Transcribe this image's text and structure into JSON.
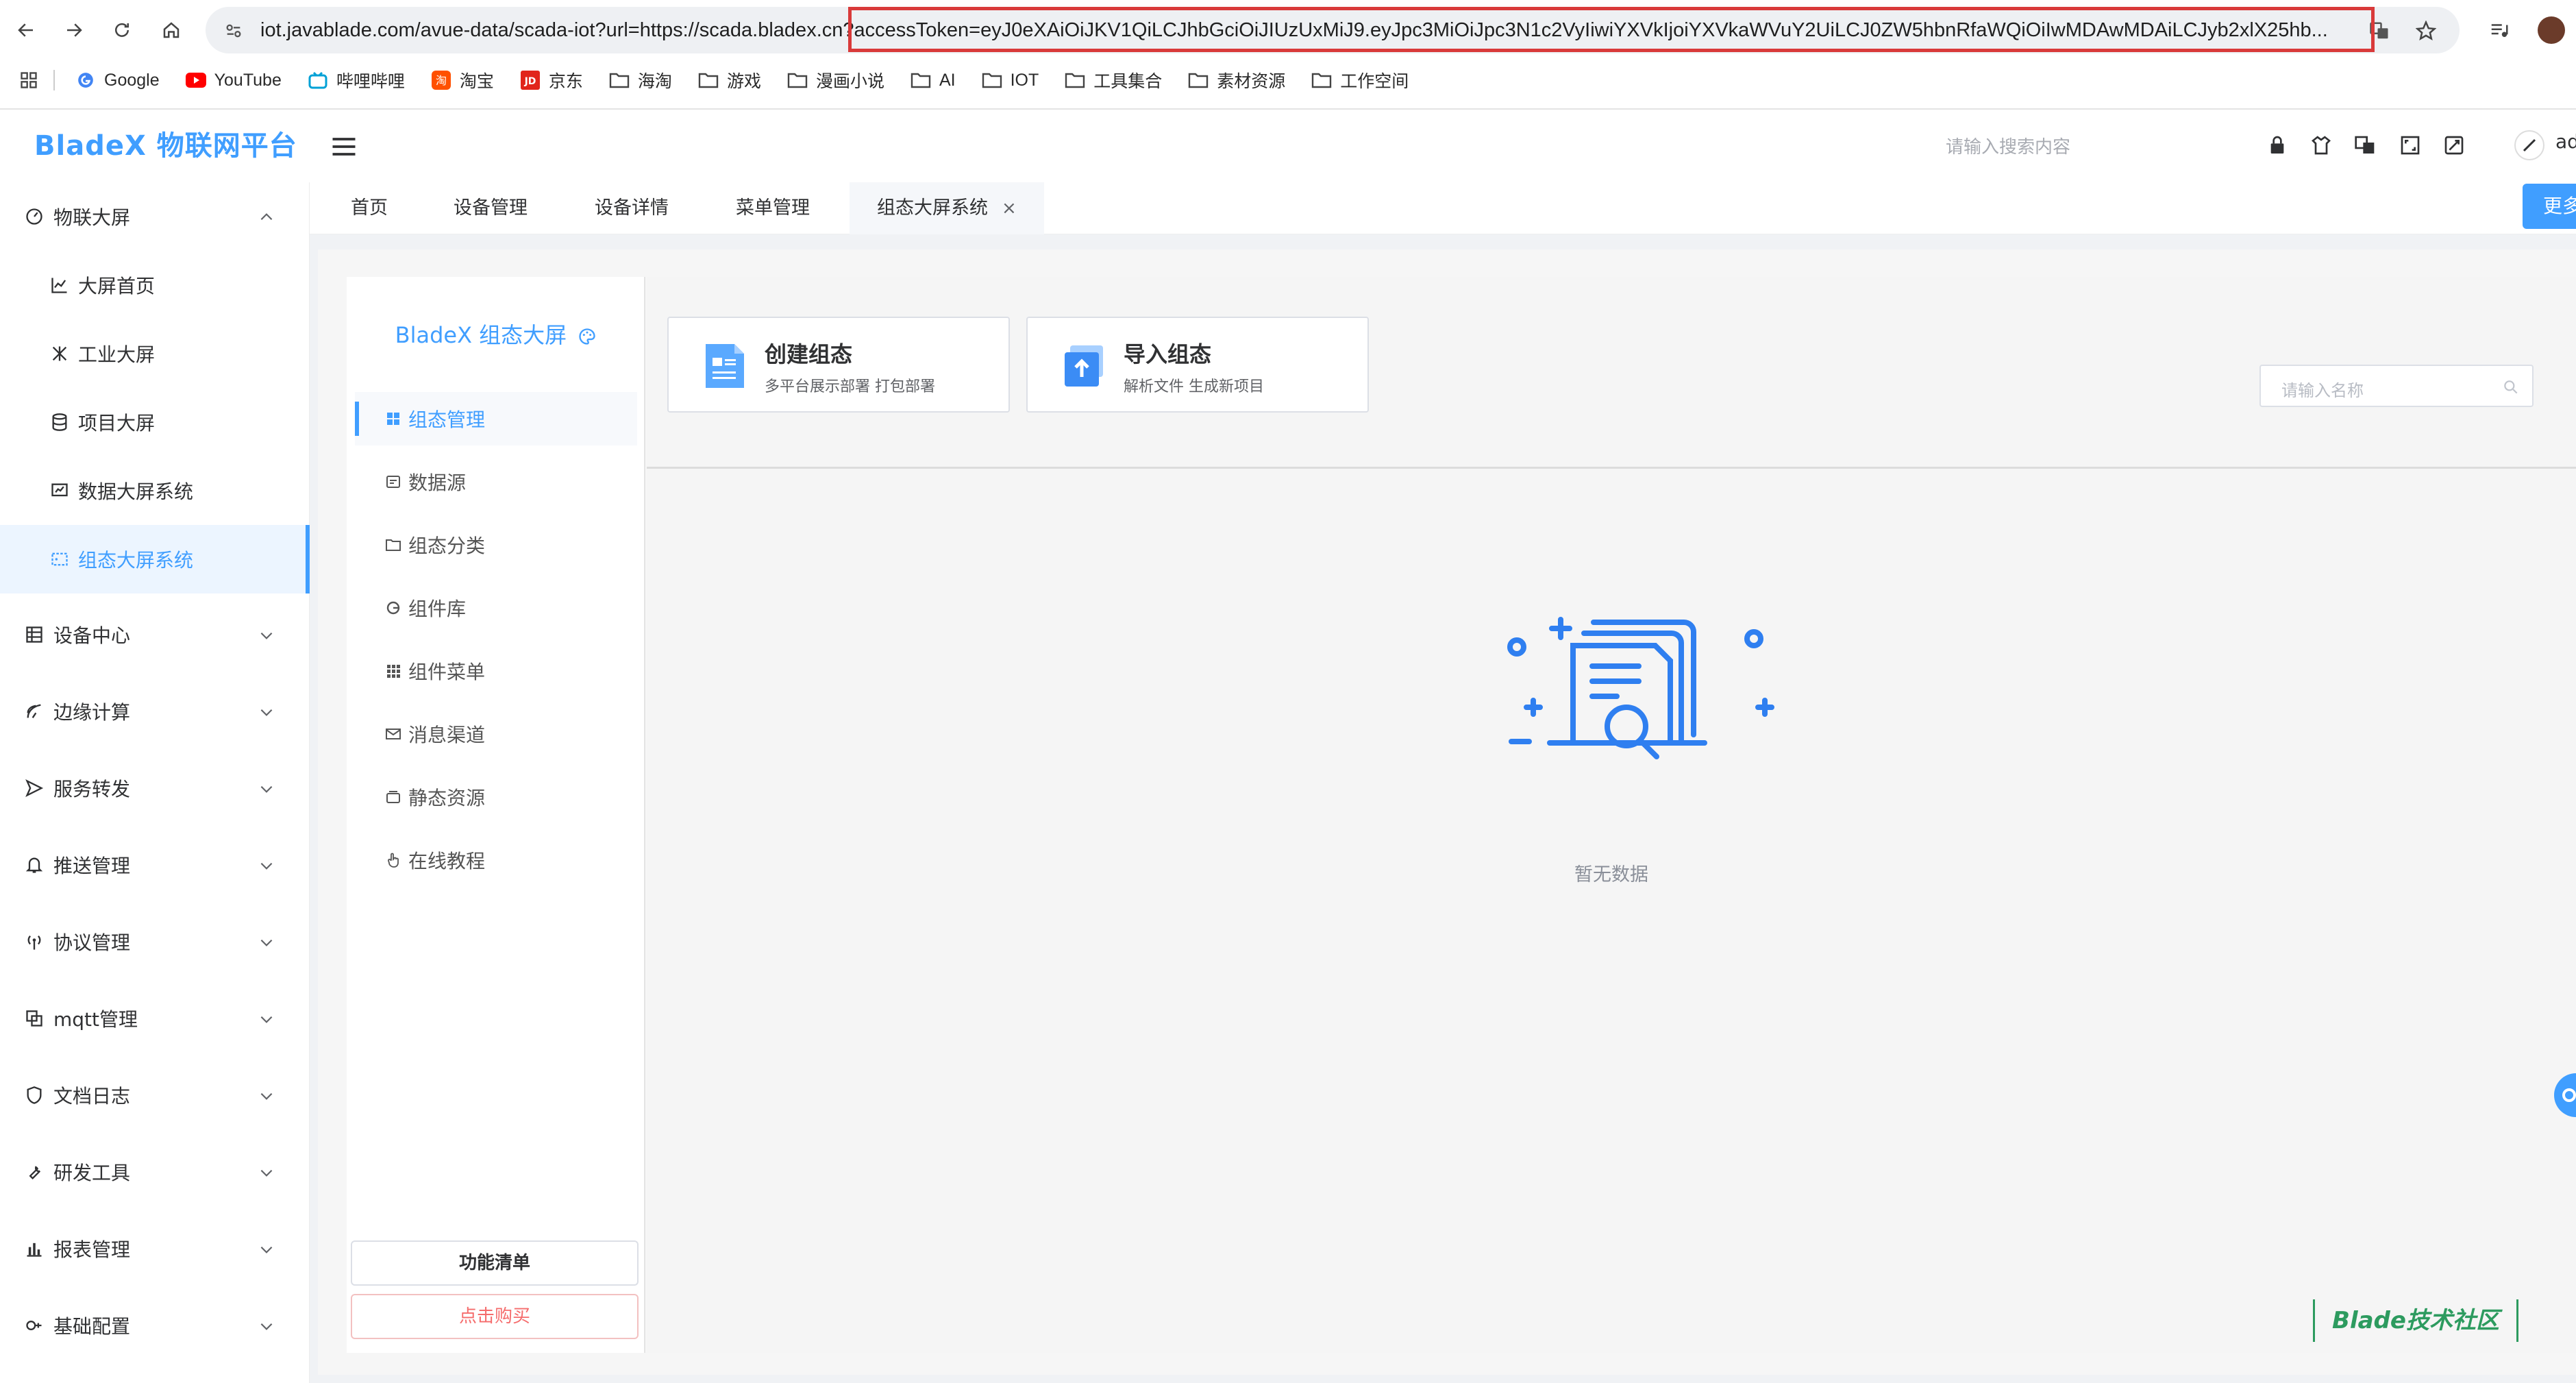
{
  "browser": {
    "url": "iot.javablade.com/avue-data/scada-iot?url=https://scada.bladex.cn?accessToken=eyJ0eXAiOiJKV1QiLCJhbGciOiJIUzUxMiJ9.eyJpc3MiOiJpc3N1c2VyIiwiYXVkIjoiYXVkaWVuY2UiLCJ0ZW5hbnRfaWQiOiIwMDAwMDAiLCJyb2xlX25hb...",
    "bookmarks": [
      {
        "label": "Google",
        "icon": "google-icon"
      },
      {
        "label": "YouTube",
        "icon": "youtube-icon"
      },
      {
        "label": "哔哩哔哩",
        "icon": "bilibili-icon"
      },
      {
        "label": "淘宝",
        "icon": "taobao-icon"
      },
      {
        "label": "京东",
        "icon": "jd-icon"
      },
      {
        "label": "海淘",
        "icon": "folder-icon"
      },
      {
        "label": "游戏",
        "icon": "folder-icon"
      },
      {
        "label": "漫画小说",
        "icon": "folder-icon"
      },
      {
        "label": "AI",
        "icon": "folder-icon"
      },
      {
        "label": "IOT",
        "icon": "folder-icon"
      },
      {
        "label": "工具集合",
        "icon": "folder-icon"
      },
      {
        "label": "素材资源",
        "icon": "folder-icon"
      },
      {
        "label": "工作空间",
        "icon": "folder-icon"
      }
    ]
  },
  "header": {
    "logo": "BladeX 物联网平台",
    "search_placeholder": "请输入搜索内容",
    "user": "ad"
  },
  "sidebar": {
    "groups": [
      {
        "label": "物联大屏",
        "icon": "dashboard-icon",
        "expanded": true
      },
      {
        "label": "设备中心",
        "icon": "device-icon"
      },
      {
        "label": "边缘计算",
        "icon": "edge-icon"
      },
      {
        "label": "服务转发",
        "icon": "send-icon"
      },
      {
        "label": "推送管理",
        "icon": "bell-icon"
      },
      {
        "label": "协议管理",
        "icon": "antenna-icon"
      },
      {
        "label": "mqtt管理",
        "icon": "mqtt-icon"
      },
      {
        "label": "文档日志",
        "icon": "shield-icon"
      },
      {
        "label": "研发工具",
        "icon": "wrench-icon"
      },
      {
        "label": "报表管理",
        "icon": "bar-chart-icon"
      },
      {
        "label": "基础配置",
        "icon": "config-icon"
      }
    ],
    "subitems": [
      {
        "label": "大屏首页",
        "icon": "line-chart-icon"
      },
      {
        "label": "工业大屏",
        "icon": "industry-icon"
      },
      {
        "label": "项目大屏",
        "icon": "database-icon"
      },
      {
        "label": "数据大屏系统",
        "icon": "data-screen-icon"
      },
      {
        "label": "组态大屏系统",
        "icon": "scada-screen-icon",
        "active": true
      }
    ]
  },
  "tabs": [
    {
      "label": "首页"
    },
    {
      "label": "设备管理"
    },
    {
      "label": "设备详情"
    },
    {
      "label": "菜单管理"
    },
    {
      "label": "组态大屏系统",
      "active": true,
      "close": "×"
    }
  ],
  "more_label": "更多",
  "scada": {
    "logo": "BladeX 组态大屏",
    "nav": [
      {
        "label": "组态管理",
        "icon": "grid-icon",
        "active": true
      },
      {
        "label": "数据源",
        "icon": "datasource-icon"
      },
      {
        "label": "组态分类",
        "icon": "folder-icon"
      },
      {
        "label": "组件库",
        "icon": "component-icon"
      },
      {
        "label": "组件菜单",
        "icon": "menu-grid-icon"
      },
      {
        "label": "消息渠道",
        "icon": "mail-icon"
      },
      {
        "label": "静态资源",
        "icon": "box-icon"
      },
      {
        "label": "在线教程",
        "icon": "hand-icon"
      }
    ],
    "feature_list_btn": "功能清单",
    "buy_btn": "点击购买",
    "create_card": {
      "title": "创建组态",
      "sub": "多平台展示部署 打包部署"
    },
    "import_card": {
      "title": "导入组态",
      "sub": "解析文件 生成新项目"
    },
    "name_search_placeholder": "请输入名称",
    "empty_text": "暂无数据",
    "watermark": "Blade技术社区"
  },
  "colors": {
    "accent": "#409eff",
    "buy": "#f56c6c",
    "highlight_box": "#d93a3a",
    "watermark": "#2d9b5f"
  }
}
